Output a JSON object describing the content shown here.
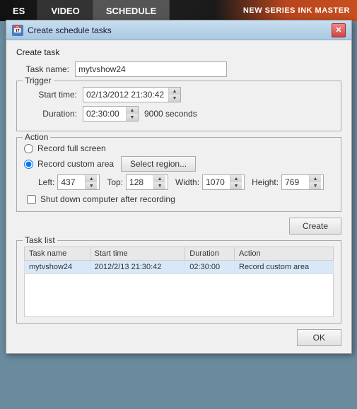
{
  "topbar": {
    "tabs": [
      {
        "label": "ES",
        "active": false
      },
      {
        "label": "VIDEO",
        "active": false
      },
      {
        "label": "SCHEDULE",
        "active": true
      }
    ],
    "brand": "NEW SERIES\nINK MASTER"
  },
  "dialog": {
    "title": "Create schedule tasks",
    "close_label": "✕",
    "create_task_label": "Create task",
    "task_name_label": "Task name:",
    "task_name_value": "mytvshow24",
    "trigger_label": "Trigger",
    "start_time_label": "Start time:",
    "start_time_value": "02/13/2012 21:30:42",
    "duration_label": "Duration:",
    "duration_value": "02:30:00",
    "seconds_label": "9000 seconds",
    "action_label": "Action",
    "record_fullscreen_label": "Record full screen",
    "record_custom_label": "Record custom area",
    "select_region_label": "Select region...",
    "left_label": "Left:",
    "left_value": "437",
    "top_label": "Top:",
    "top_value": "128",
    "width_label": "Width:",
    "width_value": "1070",
    "height_label": "Height:",
    "height_value": "769",
    "shutdown_label": "Shut down computer after recording",
    "create_btn_label": "Create",
    "task_list_label": "Task list",
    "table": {
      "headers": [
        "Task name",
        "Start time",
        "Duration",
        "Action"
      ],
      "rows": [
        [
          "mytvshow24",
          "2012/2/13 21:30:42",
          "02:30:00",
          "Record custom area"
        ]
      ]
    },
    "ok_btn_label": "OK"
  }
}
